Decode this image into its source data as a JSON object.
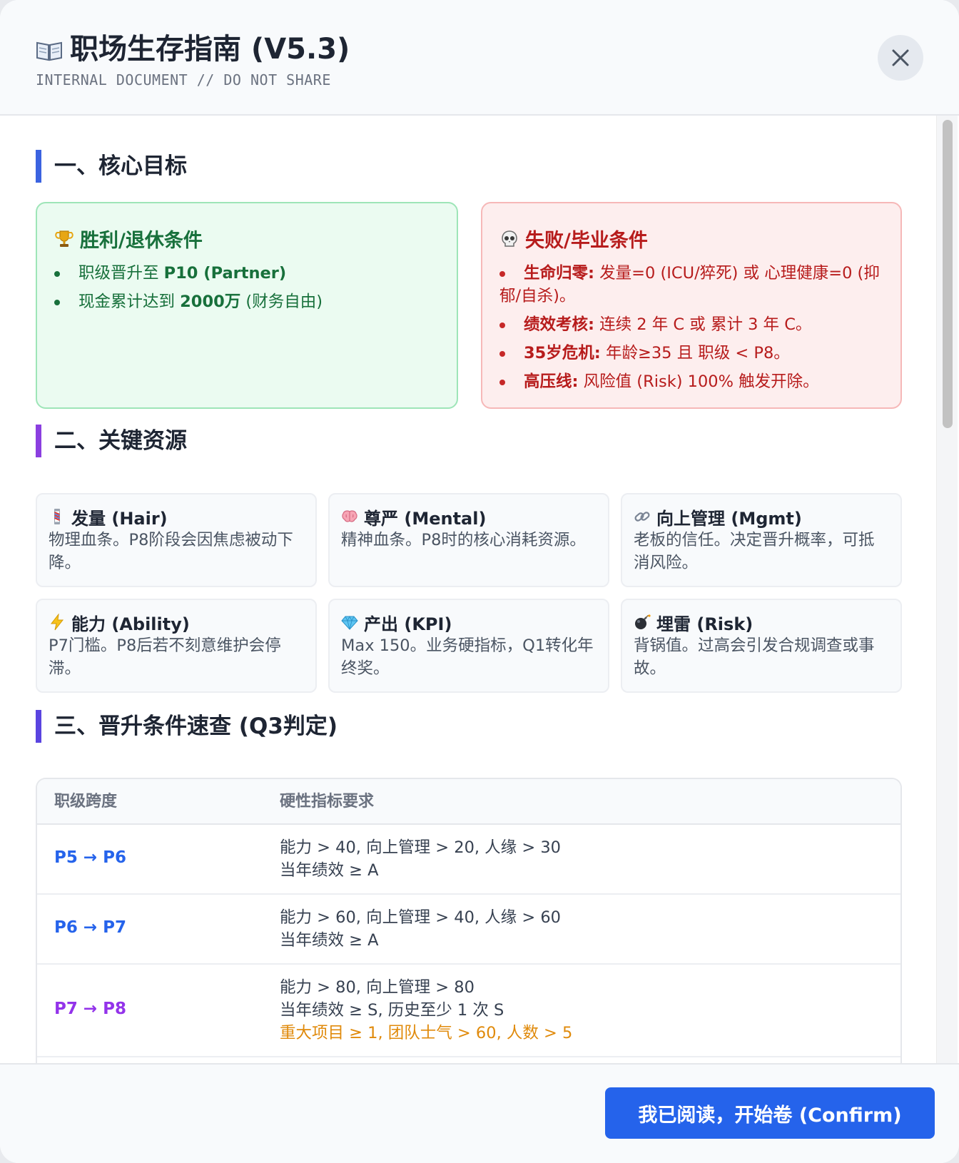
{
  "header": {
    "title": "职场生存指南 (V5.3)",
    "subtitle": "INTERNAL DOCUMENT // DO NOT SHARE"
  },
  "sections": {
    "goals": {
      "title": "一、核心目标"
    },
    "resources": {
      "title": "二、关键资源"
    },
    "promotion": {
      "title": "三、晋升条件速查 (Q3判定)"
    }
  },
  "win": {
    "title": "胜利/退休条件",
    "items": [
      {
        "pre": "职级晋升至 ",
        "bold": "P10 (Partner)",
        "post": ""
      },
      {
        "pre": "现金累计达到 ",
        "bold": "2000万",
        "post": " (财务自由)"
      }
    ]
  },
  "lose": {
    "title": "失败/毕业条件",
    "items": [
      {
        "bold": "生命归零:",
        "text": " 发量=0 (ICU/猝死) 或 心理健康=0 (抑郁/自杀)。"
      },
      {
        "bold": "绩效考核:",
        "text": " 连续 2 年 C 或 累计 3 年 C。"
      },
      {
        "bold": "35岁危机:",
        "text": " 年龄≥35 且 职级 < P8。"
      },
      {
        "bold": "高压线:",
        "text": " 风险值 (Risk) 100% 触发开除。"
      }
    ]
  },
  "resources": [
    {
      "icon": "barber-pole-icon",
      "title": "发量 (Hair)",
      "desc": "物理血条。P8阶段会因焦虑被动下降。"
    },
    {
      "icon": "brain-icon",
      "title": "尊严 (Mental)",
      "desc": "精神血条。P8时的核心消耗资源。"
    },
    {
      "icon": "link-icon",
      "title": "向上管理 (Mgmt)",
      "desc": "老板的信任。决定晋升概率，可抵消风险。"
    },
    {
      "icon": "lightning-icon",
      "title": "能力 (Ability)",
      "desc": "P7门槛。P8后若不刻意维护会停滞。"
    },
    {
      "icon": "gem-icon",
      "title": "产出 (KPI)",
      "desc": "Max 150。业务硬指标，Q1转化年终奖。"
    },
    {
      "icon": "bomb-icon",
      "title": "埋雷 (Risk)",
      "desc": "背锅值。过高会引发合规调查或事故。"
    }
  ],
  "table": {
    "headers": [
      "职级跨度",
      "硬性指标要求"
    ],
    "rows": [
      {
        "rank": "P5 → P6",
        "color": "#2563eb",
        "lines": [
          "能力 > 40, 向上管理 > 20, 人缘 > 30",
          "当年绩效 ≥ A"
        ],
        "warn": ""
      },
      {
        "rank": "P6 → P7",
        "color": "#2563eb",
        "lines": [
          "能力 > 60, 向上管理 > 40, 人缘 > 60",
          "当年绩效 ≥ A"
        ],
        "warn": ""
      },
      {
        "rank": "P7 → P8",
        "color": "#9333ea",
        "lines": [
          "能力 > 80, 向上管理 > 80",
          "当年绩效 ≥ S, 历史至少 1 次 S"
        ],
        "warn": "重大项目 ≥ 1, 团队士气 > 60, 人数 > 5"
      }
    ]
  },
  "footer": {
    "confirm_label": "我已阅读，开始卷 (Confirm)"
  },
  "colors": {
    "accent": "#2563eb",
    "success": "#17703b",
    "danger": "#b71c1c",
    "warning": "#e08a0b",
    "purple": "#9333ea"
  }
}
